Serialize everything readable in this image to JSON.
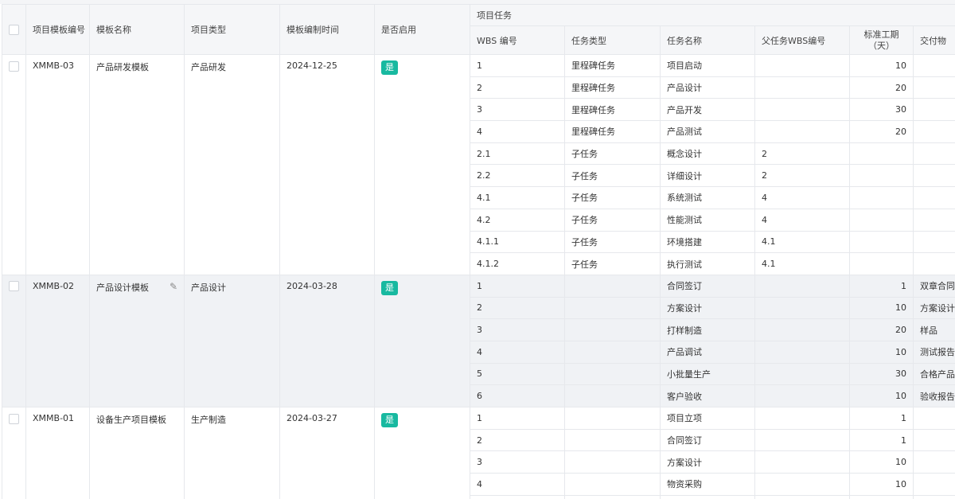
{
  "headers": {
    "template_no": "项目模板编号",
    "template_name": "模板名称",
    "project_type": "项目类型",
    "template_time": "模板编制时间",
    "enabled": "是否启用",
    "project_tasks": "项目任务",
    "wbs": "WBS 编号",
    "task_type": "任务类型",
    "task_name": "任务名称",
    "parent_wbs": "父任务WBS编号",
    "std_period_line1": "标准工期",
    "std_period_line2": "（天）",
    "deliverable": "交付物"
  },
  "templates": [
    {
      "no": "XMMB-03",
      "name": "产品研发模板",
      "type": "产品研发",
      "time": "2024-12-25",
      "enabled": "是",
      "tasks": [
        {
          "wbs": "1",
          "type": "里程碑任务",
          "name": "项目启动",
          "parent": "",
          "days": "10",
          "deliv": ""
        },
        {
          "wbs": "2",
          "type": "里程碑任务",
          "name": "产品设计",
          "parent": "",
          "days": "20",
          "deliv": ""
        },
        {
          "wbs": "3",
          "type": "里程碑任务",
          "name": "产品开发",
          "parent": "",
          "days": "30",
          "deliv": ""
        },
        {
          "wbs": "4",
          "type": "里程碑任务",
          "name": "产品测试",
          "parent": "",
          "days": "20",
          "deliv": ""
        },
        {
          "wbs": "2.1",
          "type": "子任务",
          "name": "概念设计",
          "parent": "2",
          "days": "",
          "deliv": ""
        },
        {
          "wbs": "2.2",
          "type": "子任务",
          "name": "详细设计",
          "parent": "2",
          "days": "",
          "deliv": ""
        },
        {
          "wbs": "4.1",
          "type": "子任务",
          "name": "系统测试",
          "parent": "4",
          "days": "",
          "deliv": ""
        },
        {
          "wbs": "4.2",
          "type": "子任务",
          "name": "性能测试",
          "parent": "4",
          "days": "",
          "deliv": ""
        },
        {
          "wbs": "4.1.1",
          "type": "子任务",
          "name": "环境搭建",
          "parent": "4.1",
          "days": "",
          "deliv": ""
        },
        {
          "wbs": "4.1.2",
          "type": "子任务",
          "name": "执行测试",
          "parent": "4.1",
          "days": "",
          "deliv": ""
        }
      ]
    },
    {
      "no": "XMMB-02",
      "name": "产品设计模板",
      "type": "产品设计",
      "time": "2024-03-28",
      "enabled": "是",
      "tasks": [
        {
          "wbs": "1",
          "type": "",
          "name": "合同签订",
          "parent": "",
          "days": "1",
          "deliv": "双章合同"
        },
        {
          "wbs": "2",
          "type": "",
          "name": "方案设计",
          "parent": "",
          "days": "10",
          "deliv": "方案设计图"
        },
        {
          "wbs": "3",
          "type": "",
          "name": "打样制造",
          "parent": "",
          "days": "20",
          "deliv": "样品"
        },
        {
          "wbs": "4",
          "type": "",
          "name": "产品调试",
          "parent": "",
          "days": "10",
          "deliv": "测试报告"
        },
        {
          "wbs": "5",
          "type": "",
          "name": "小批量生产",
          "parent": "",
          "days": "30",
          "deliv": "合格产品数"
        },
        {
          "wbs": "6",
          "type": "",
          "name": "客户验收",
          "parent": "",
          "days": "10",
          "deliv": "验收报告"
        }
      ]
    },
    {
      "no": "XMMB-01",
      "name": "设备生产项目模板",
      "type": "生产制造",
      "time": "2024-03-27",
      "enabled": "是",
      "tasks": [
        {
          "wbs": "1",
          "type": "",
          "name": "项目立项",
          "parent": "",
          "days": "1",
          "deliv": ""
        },
        {
          "wbs": "2",
          "type": "",
          "name": "合同签订",
          "parent": "",
          "days": "1",
          "deliv": ""
        },
        {
          "wbs": "3",
          "type": "",
          "name": "方案设计",
          "parent": "",
          "days": "10",
          "deliv": ""
        },
        {
          "wbs": "4",
          "type": "",
          "name": "物资采购",
          "parent": "",
          "days": "10",
          "deliv": ""
        },
        {
          "wbs": "",
          "type": "",
          "name": "",
          "parent": "",
          "days": "",
          "deliv": ""
        }
      ]
    }
  ],
  "colors": {
    "badge": "#18b9a0",
    "highlight_row": "#f0f2f5",
    "header_bg": "#f5f6f8"
  }
}
